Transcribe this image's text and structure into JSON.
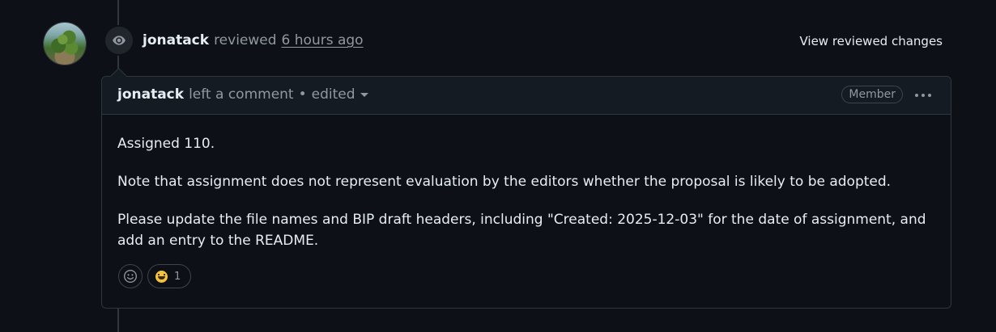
{
  "event": {
    "author": "jonatack",
    "action": "reviewed",
    "time": "6 hours ago",
    "view_changes_label": "View reviewed changes",
    "icon": "eye-icon"
  },
  "comment": {
    "author": "jonatack",
    "action": "left a comment",
    "separator": "•",
    "edited_label": "edited",
    "role_badge": "Member",
    "paragraphs": [
      "Assigned 110.",
      "Note that assignment does not represent evaluation by the editors whether the proposal is likely to be adopted.",
      "Please update the file names and BIP draft headers, including \"Created: 2025-12-03\" for the date of assignment, and add an entry to the README."
    ],
    "reactions": {
      "add_icon": "smiley-icon",
      "items": [
        {
          "emoji": "grinning-face-icon",
          "count": "1"
        }
      ]
    }
  },
  "colors": {
    "background": "#0d1117",
    "border": "#30363d",
    "header_bg": "#151b23",
    "text": "#e6edf3",
    "muted": "#9198a1"
  }
}
